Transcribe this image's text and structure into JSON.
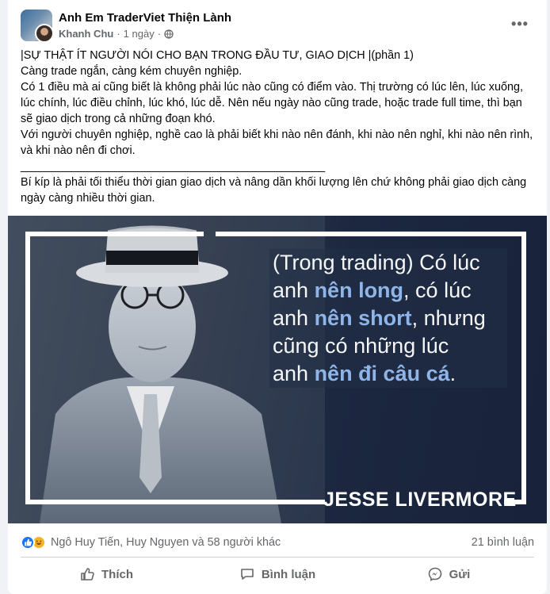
{
  "post": {
    "group_name": "Anh Em TraderViet Thiện Lành",
    "author": "Khanh Chu",
    "separator": "·",
    "time": "1 ngày",
    "more_label": "•••",
    "text_lines": [
      "|SỰ THẬT ÍT NGƯỜI NÓI CHO BẠN TRONG ĐẦU TƯ, GIAO DỊCH |(phần 1)",
      "Càng trade ngắn, càng kém chuyên nghiệp.",
      "Có 1 điều mà ai cũng biết là không phải lúc nào cũng có điểm vào. Thị trường có lúc lên, lúc xuống, lúc chính, lúc điều chỉnh, lúc khó, lúc dễ. Nên nếu ngày nào cũng trade, hoặc trade full time, thì bạn sẽ giao dịch trong cả những đoạn khó.",
      "Với người chuyên nghiệp, nghề cao là phải biết khi nào nên đánh, khi nào nên nghỉ, khi nào nên rình, và khi nào nên đi chơi.",
      "________________________________________________",
      "Bí kíp là phải tối thiểu thời gian giao dịch và nâng dần khối lượng lên chứ không phải giao dịch càng ngày càng nhiều thời gian."
    ]
  },
  "image": {
    "quote_l1_a": "(Trong trading) Có lúc",
    "quote_l2_a": "anh ",
    "quote_l2_b": "nên long",
    "quote_l2_c": ", có lúc",
    "quote_l3_a": "anh ",
    "quote_l3_b": "nên short",
    "quote_l3_c": ", nhưng",
    "quote_l4": "cũng có những lúc",
    "quote_l5_a": "anh ",
    "quote_l5_b": "nên đi câu cá",
    "quote_l5_c": ".",
    "signature": "JESSE LIVERMORE"
  },
  "reactions": {
    "names": "Ngô Huy Tiến, Huy Nguyen và 58 người khác",
    "comments_count": "21 bình luận"
  },
  "actions": {
    "like": "Thích",
    "comment": "Bình luận",
    "share": "Gửi"
  },
  "colors": {
    "accent": "#1877f2",
    "quote_highlight": "#8fb5e8",
    "image_bg": "#1c2740"
  }
}
